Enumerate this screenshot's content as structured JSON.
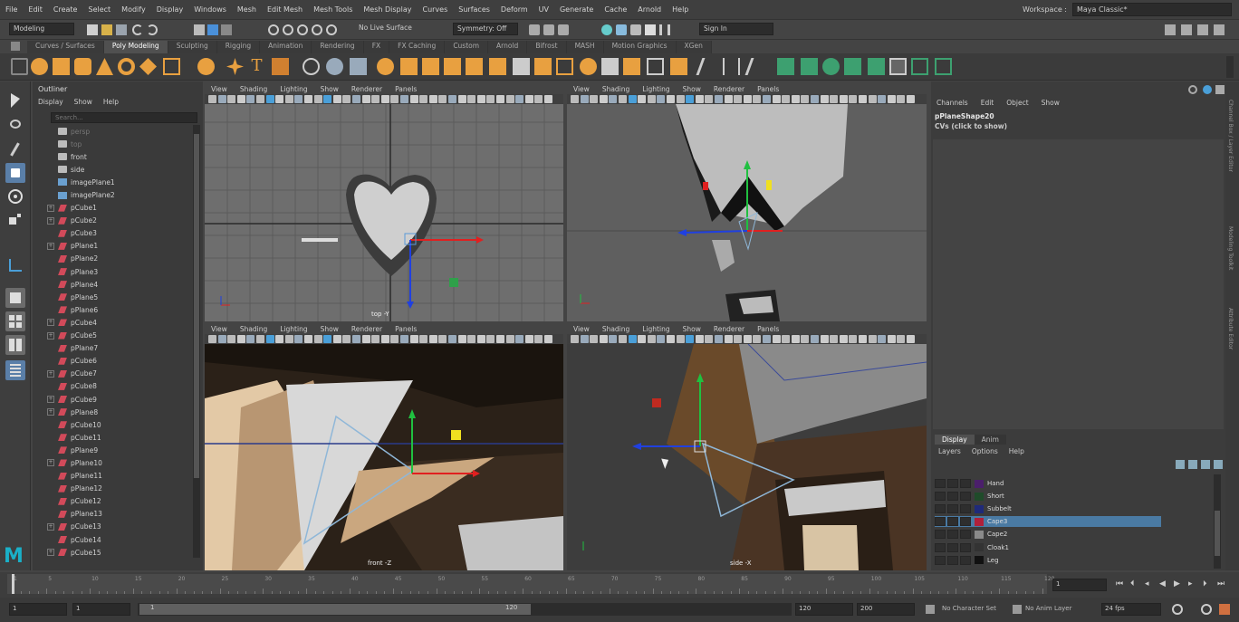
{
  "menubar": {
    "items": [
      "File",
      "Edit",
      "Create",
      "Select",
      "Modify",
      "Display",
      "Windows",
      "Mesh",
      "Edit Mesh",
      "Mesh Tools",
      "Mesh Display",
      "Curves",
      "Surfaces",
      "Deform",
      "UV",
      "Generate",
      "Cache",
      "Arnold",
      "Help"
    ],
    "workspace_label": "Workspace :",
    "workspace_value": "Maya Classic*"
  },
  "statusline": {
    "mode": "Modeling",
    "live_surface": "No Live Surface",
    "symmetry": "Symmetry: Off",
    "sign_in": "Sign In"
  },
  "shelf": {
    "tabs": [
      "Curves / Surfaces",
      "Poly Modeling",
      "Sculpting",
      "Rigging",
      "Animation",
      "Rendering",
      "FX",
      "FX Caching",
      "Custom",
      "Arnold",
      "Bifrost",
      "MASH",
      "Motion Graphics",
      "XGen"
    ],
    "active_tab": "Poly Modeling"
  },
  "outliner": {
    "title": "Outliner",
    "menu": [
      "Display",
      "Show",
      "Help"
    ],
    "search_placeholder": "Search...",
    "items": [
      {
        "label": "persp",
        "type": "camera",
        "dim": true,
        "expand": false
      },
      {
        "label": "top",
        "type": "camera",
        "dim": true,
        "expand": false
      },
      {
        "label": "front",
        "type": "camera",
        "dim": false,
        "expand": false
      },
      {
        "label": "side",
        "type": "camera",
        "dim": false,
        "expand": false
      },
      {
        "label": "imagePlane1",
        "type": "image",
        "dim": false,
        "expand": false
      },
      {
        "label": "imagePlane2",
        "type": "image",
        "dim": false,
        "expand": false
      },
      {
        "label": "pCube1",
        "type": "mesh",
        "dim": false,
        "expand": true
      },
      {
        "label": "pCube2",
        "type": "mesh",
        "dim": false,
        "expand": true
      },
      {
        "label": "pCube3",
        "type": "mesh",
        "dim": false,
        "expand": false
      },
      {
        "label": "pPlane1",
        "type": "mesh",
        "dim": false,
        "expand": true
      },
      {
        "label": "pPlane2",
        "type": "mesh",
        "dim": false,
        "expand": false
      },
      {
        "label": "pPlane3",
        "type": "mesh",
        "dim": false,
        "expand": false
      },
      {
        "label": "pPlane4",
        "type": "mesh",
        "dim": false,
        "expand": false
      },
      {
        "label": "pPlane5",
        "type": "mesh",
        "dim": false,
        "expand": false
      },
      {
        "label": "pPlane6",
        "type": "mesh",
        "dim": false,
        "expand": false
      },
      {
        "label": "pCube4",
        "type": "mesh",
        "dim": false,
        "expand": true
      },
      {
        "label": "pCube5",
        "type": "mesh",
        "dim": false,
        "expand": true
      },
      {
        "label": "pPlane7",
        "type": "mesh",
        "dim": false,
        "expand": false
      },
      {
        "label": "pCube6",
        "type": "mesh",
        "dim": false,
        "expand": false
      },
      {
        "label": "pCube7",
        "type": "mesh",
        "dim": false,
        "expand": true
      },
      {
        "label": "pCube8",
        "type": "mesh",
        "dim": false,
        "expand": false
      },
      {
        "label": "pCube9",
        "type": "mesh",
        "dim": false,
        "expand": true
      },
      {
        "label": "pPlane8",
        "type": "mesh",
        "dim": false,
        "expand": true
      },
      {
        "label": "pCube10",
        "type": "mesh",
        "dim": false,
        "expand": false
      },
      {
        "label": "pCube11",
        "type": "mesh",
        "dim": false,
        "expand": false
      },
      {
        "label": "pPlane9",
        "type": "mesh",
        "dim": false,
        "expand": false
      },
      {
        "label": "pPlane10",
        "type": "mesh",
        "dim": false,
        "expand": true
      },
      {
        "label": "pPlane11",
        "type": "mesh",
        "dim": false,
        "expand": false
      },
      {
        "label": "pPlane12",
        "type": "mesh",
        "dim": false,
        "expand": false
      },
      {
        "label": "pCube12",
        "type": "mesh",
        "dim": false,
        "expand": false
      },
      {
        "label": "pPlane13",
        "type": "mesh",
        "dim": false,
        "expand": false
      },
      {
        "label": "pCube13",
        "type": "mesh",
        "dim": false,
        "expand": true
      },
      {
        "label": "pCube14",
        "type": "mesh",
        "dim": false,
        "expand": false
      },
      {
        "label": "pCube15",
        "type": "mesh",
        "dim": false,
        "expand": true
      }
    ]
  },
  "viewport_menu": [
    "View",
    "Shading",
    "Lighting",
    "Show",
    "Renderer",
    "Panels"
  ],
  "viewports": {
    "top_left_label": "top -Y",
    "bottom_left_label": "front -Z",
    "bottom_right_label": "side -X"
  },
  "channelbox": {
    "menu": [
      "Channels",
      "Edit",
      "Object",
      "Show"
    ],
    "node_name": "pPlaneShape20",
    "cvs_text": "CVs (click to show)"
  },
  "layers": {
    "tabs": [
      "Display",
      "Anim"
    ],
    "active_tab": "Display",
    "menu": [
      "Layers",
      "Options",
      "Help"
    ],
    "items": [
      {
        "name": "Hand",
        "color": "#4b1f6b",
        "selected": false
      },
      {
        "name": "Short",
        "color": "#1f4b2a",
        "selected": false
      },
      {
        "name": "Subbelt",
        "color": "#1f2a7a",
        "selected": false
      },
      {
        "name": "Cape3",
        "color": "#b0203a",
        "selected": true
      },
      {
        "name": "Cape2",
        "color": "#8a8a8a",
        "selected": false
      },
      {
        "name": "Cloak1",
        "color": "#333333",
        "selected": false
      },
      {
        "name": "Leg",
        "color": "#111111",
        "selected": false
      }
    ]
  },
  "rightstrip": [
    "Channel Box / Layer Editor",
    "Modeling Toolkit",
    "Attribute Editor"
  ],
  "timeline": {
    "ticks": [
      "1",
      "5",
      "10",
      "15",
      "20",
      "25",
      "30",
      "35",
      "40",
      "45",
      "50",
      "55",
      "60",
      "65",
      "70",
      "75",
      "80",
      "85",
      "90",
      "95",
      "100",
      "105",
      "110",
      "115",
      "120"
    ],
    "current_frame": "1"
  },
  "range": {
    "start": "1",
    "start_inner": "1",
    "slider_start": "1",
    "slider_end": "120",
    "end_inner": "120",
    "end": "200",
    "character_set": "No Character Set",
    "anim_layer": "No Anim Layer",
    "fps": "24 fps"
  },
  "colors": {
    "accent": "#f0a030",
    "selected_layer": "#4a7aa3",
    "viewport_bg": "#6a6a6a",
    "maya_logo": "#1ab0c8"
  }
}
